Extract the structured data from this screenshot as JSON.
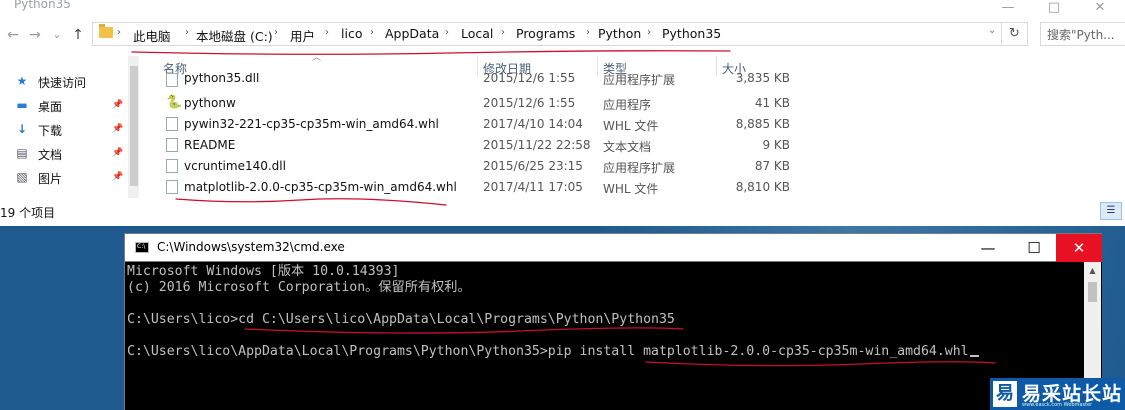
{
  "explorer": {
    "title": "Python35",
    "window_controls": [
      "—",
      "□",
      "✕"
    ],
    "nav_buttons": [
      "←",
      "→",
      "⌄",
      "↑"
    ],
    "breadcrumb": [
      "此电脑",
      "本地磁盘 (C:)",
      "用户",
      "lico",
      "AppData",
      "Local",
      "Programs",
      "Python",
      "Python35"
    ],
    "dropdown_glyph": "⌄",
    "refresh_glyph": "↻",
    "search_placeholder": "搜索\"Pyth...",
    "sidebar": [
      {
        "label": "快速访问",
        "icon": "star-icon",
        "glyph": "★"
      },
      {
        "label": "桌面",
        "icon": "desktop-icon",
        "glyph": "▬"
      },
      {
        "label": "下载",
        "icon": "download-icon",
        "glyph": "↓"
      },
      {
        "label": "文档",
        "icon": "document-icon",
        "glyph": "▤"
      },
      {
        "label": "图片",
        "icon": "picture-icon",
        "glyph": "▧"
      }
    ],
    "pin_glyph": "📌",
    "columns": {
      "name": "名称",
      "date": "修改日期",
      "type": "类型",
      "size": "大小"
    },
    "files": [
      {
        "name": "python35.dll",
        "date": "2015/12/6 1:55",
        "type": "应用程序扩展",
        "size": "3,835 KB",
        "icon": "file-icon"
      },
      {
        "name": "pythonw",
        "date": "2015/12/6 1:55",
        "type": "应用程序",
        "size": "41 KB",
        "icon": "python-icon"
      },
      {
        "name": "pywin32-221-cp35-cp35m-win_amd64.whl",
        "date": "2017/4/10 14:04",
        "type": "WHL 文件",
        "size": "8,885 KB",
        "icon": "file-icon"
      },
      {
        "name": "README",
        "date": "2015/11/22 22:58",
        "type": "文本文档",
        "size": "9 KB",
        "icon": "text-file-icon"
      },
      {
        "name": "vcruntime140.dll",
        "date": "2015/6/25 23:15",
        "type": "应用程序扩展",
        "size": "87 KB",
        "icon": "file-icon"
      },
      {
        "name": "matplotlib-2.0.0-cp35-cp35m-win_amd64.whl",
        "date": "2017/4/11 17:05",
        "type": "WHL 文件",
        "size": "8,810 KB",
        "icon": "file-icon"
      }
    ],
    "status": "19 个项目",
    "view_glyph": "☰"
  },
  "cmd": {
    "title": "C:\\Windows\\system32\\cmd.exe",
    "controls": [
      "—",
      "☐",
      "✕"
    ],
    "lines": [
      "Microsoft Windows [版本 10.0.14393]",
      "(c) 2016 Microsoft Corporation。保留所有权利。",
      "",
      "C:\\Users\\lico>cd C:\\Users\\lico\\AppData\\Local\\Programs\\Python\\Python35",
      "",
      "C:\\Users\\lico\\AppData\\Local\\Programs\\Python\\Python35>pip install matplotlib-2.0.0-cp35-cp35m-win_amd64.whl"
    ]
  },
  "watermark": {
    "logo": "易",
    "text": "易采站长站",
    "sub": "www.easck.com  Webmaster"
  },
  "colors": {
    "annotation_ink": "#c8102e",
    "desktop": "#1f5a8e",
    "close": "#e81123",
    "watermark": "#0e5aa7"
  }
}
